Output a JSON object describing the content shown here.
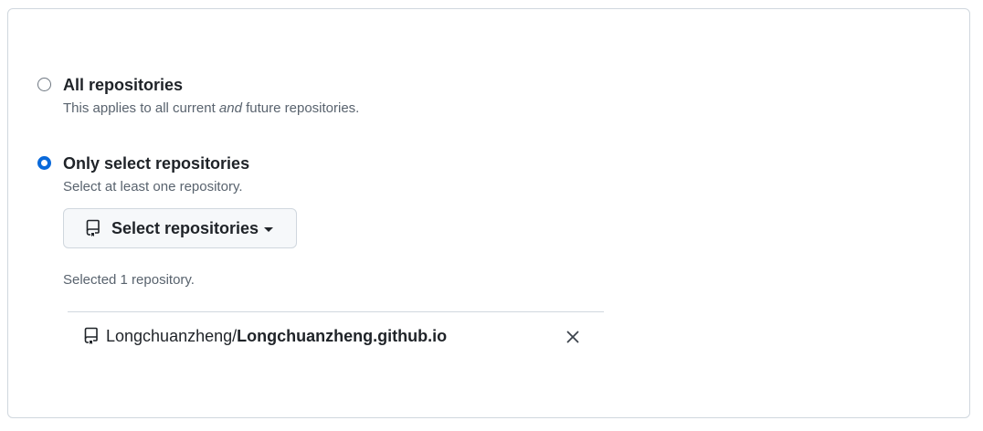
{
  "access": {
    "options": [
      {
        "title": "All repositories",
        "desc_before": "This applies to all current ",
        "desc_em": "and",
        "desc_after": " future repositories.",
        "checked": false
      },
      {
        "title": "Only select repositories",
        "desc": "Select at least one repository.",
        "checked": true
      }
    ],
    "select_button_label": "Select repositories",
    "selected_count_text": "Selected 1 repository.",
    "repositories": [
      {
        "owner": "Longchuanzheng/",
        "name": "Longchuanzheng.github.io"
      }
    ]
  },
  "colors": {
    "accent": "#0969da",
    "border": "#d0d7de",
    "muted_text": "#59636e",
    "text": "#1f2328"
  },
  "icons": [
    "repo-icon",
    "triangle-down-icon",
    "x-icon"
  ]
}
